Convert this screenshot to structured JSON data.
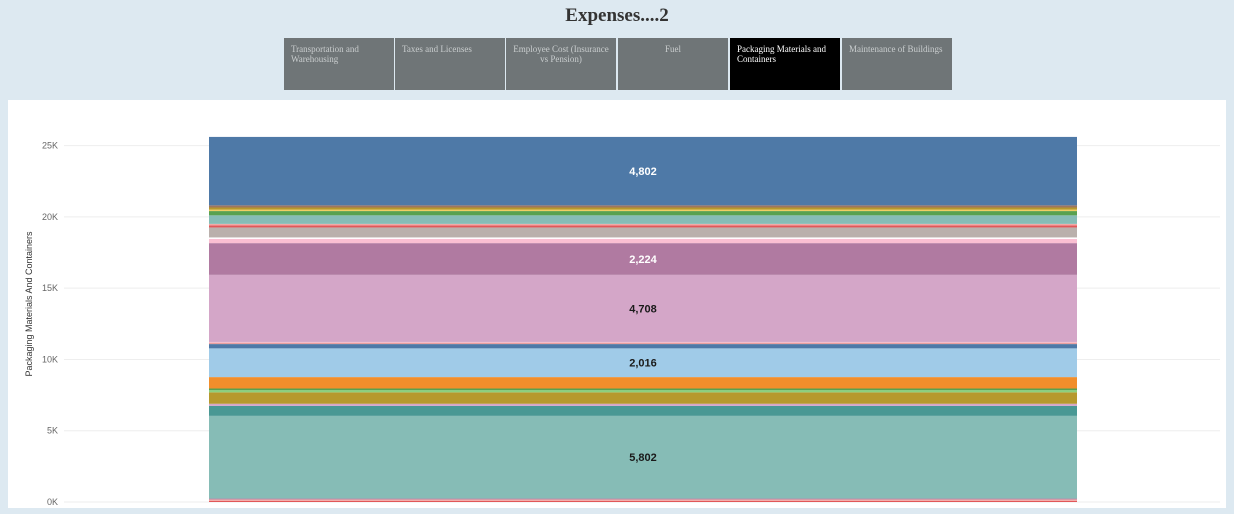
{
  "dashboard": {
    "title": "Expenses....2",
    "tabs": [
      {
        "label": "Transportation and Warehousing",
        "selected": false
      },
      {
        "label": "Taxes and Licenses",
        "selected": false
      },
      {
        "label": "Employee Cost (Insurance vs Pension)",
        "selected": false
      },
      {
        "label": "Fuel",
        "selected": false
      },
      {
        "label": "Packaging Materials and Containers",
        "selected": true
      },
      {
        "label": "Maintenance of Buildings",
        "selected": false
      }
    ]
  },
  "chart_data": {
    "type": "bar",
    "stacked": true,
    "ylabel": "Packaging Materials And Containers",
    "ylim": [
      0,
      27500
    ],
    "yticks": [
      0,
      5000,
      10000,
      15000,
      20000,
      25000
    ],
    "ytick_labels": [
      "0K",
      "5K",
      "10K",
      "15K",
      "20K",
      "25K"
    ],
    "grid": true,
    "segments": [
      {
        "value": 80,
        "color": "#e15759"
      },
      {
        "value": 100,
        "color": "#f1a9a5"
      },
      {
        "value": 60,
        "color": "#b07aa1"
      },
      {
        "value": 5802,
        "color": "#86bcb6",
        "label": "5,802",
        "label_color": "#1a1a1a"
      },
      {
        "value": 700,
        "color": "#499894"
      },
      {
        "value": 150,
        "color": "#d4a6c8"
      },
      {
        "value": 800,
        "color": "#b6992d"
      },
      {
        "value": 150,
        "color": "#8cd17d"
      },
      {
        "value": 120,
        "color": "#59a14f"
      },
      {
        "value": 800,
        "color": "#f28e2b"
      },
      {
        "value": 2016,
        "color": "#a0cbe8",
        "label": "2,016",
        "label_color": "#1a1a1a"
      },
      {
        "value": 300,
        "color": "#4e79a7"
      },
      {
        "value": 100,
        "color": "#e8a0a0"
      },
      {
        "value": 50,
        "color": "#fabfd2"
      },
      {
        "value": 4708,
        "color": "#d4a6c8",
        "label": "4,708",
        "label_color": "#1a1a1a"
      },
      {
        "value": 2224,
        "color": "#b07aa1",
        "label": "2,224",
        "label_color": "#ffffff"
      },
      {
        "value": 300,
        "color": "#fabfd2"
      },
      {
        "value": 100,
        "color": "#ffffff"
      },
      {
        "value": 700,
        "color": "#bab0ac"
      },
      {
        "value": 150,
        "color": "#e15759"
      },
      {
        "value": 100,
        "color": "#f1a9a5"
      },
      {
        "value": 600,
        "color": "#86bcb6"
      },
      {
        "value": 300,
        "color": "#59a14f"
      },
      {
        "value": 100,
        "color": "#f1ce63"
      },
      {
        "value": 150,
        "color": "#b6992d"
      },
      {
        "value": 150,
        "color": "#9d7660"
      },
      {
        "value": 4802,
        "color": "#4e79a7",
        "label": "4,802",
        "label_color": "#ffffff"
      }
    ]
  }
}
